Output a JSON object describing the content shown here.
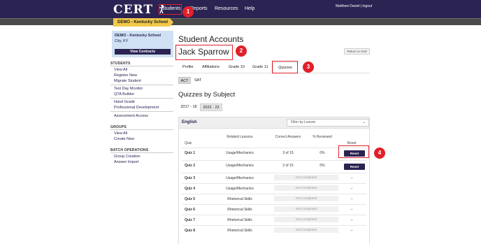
{
  "nav": {
    "logo_text": "CERT",
    "students": "Students",
    "reports": "Reports",
    "resources": "Resources",
    "help": "Help",
    "user_name": "Matthew Daniel",
    "separator": " | ",
    "logout": "logout"
  },
  "breadcrumb": {
    "school": "DEMO - Kentucky School"
  },
  "school_card": {
    "name": "DEMO - Kentucky School",
    "location": "City, KY",
    "button": "View Contracts"
  },
  "sidebar": {
    "students_heading": "STUDENTS",
    "students_links": [
      "View All",
      "Register New",
      "Migrate Student",
      "Test Day Monitor",
      "QTA Builder",
      "Hand Grade",
      "Professional Development",
      "Assessment Access"
    ],
    "groups_heading": "GROUPS",
    "groups_links": [
      "View All",
      "Create New"
    ],
    "batch_heading": "BATCH OPERATIONS",
    "batch_links": [
      "Group Creation",
      "Answer Import"
    ]
  },
  "main": {
    "page_title": "Student Accounts",
    "student_name": "Jack Sparrow",
    "return_button": "Return to Grid",
    "tabs": [
      "Profile",
      "Affiliations",
      "Grade 10",
      "Grade 11",
      "Quizzes"
    ],
    "active_tab": "Quizzes",
    "test_pills": [
      "ACT",
      "SAT"
    ],
    "active_test": "ACT",
    "section_title": "Quizzes by Subject",
    "years": [
      "2017 - 18",
      "2022 - 23"
    ],
    "active_year": "2022 - 23"
  },
  "panel": {
    "subject": "English",
    "filter_placeholder": "Filter by Lesson",
    "headers": {
      "quiz": "Quiz",
      "lessons": "Related Lessons",
      "correct": "Correct Answers",
      "reviewed": "% Reviewed",
      "reset": "Reset"
    },
    "rows": [
      {
        "quiz": "Quiz 1",
        "lesson": "Usage/Mechanics",
        "correct": "3 of 15",
        "reviewed": "0%",
        "reset": "Reset"
      },
      {
        "quiz": "Quiz 2",
        "lesson": "Usage/Mechanics",
        "correct": "2 of 15",
        "reviewed": "0%",
        "reset": "Reset"
      },
      {
        "quiz": "Quiz 3",
        "lesson": "Usage/Mechanics",
        "status": "Not Completed",
        "reset": "--"
      },
      {
        "quiz": "Quiz 4",
        "lesson": "Usage/Mechanics",
        "status": "Not Completed",
        "reset": "--"
      },
      {
        "quiz": "Quiz 5",
        "lesson": "Rhetorical Skills",
        "status": "Not Completed",
        "reset": "--"
      },
      {
        "quiz": "Quiz 6",
        "lesson": "Rhetorical Skills",
        "status": "Not Completed",
        "reset": "--"
      },
      {
        "quiz": "Quiz 7",
        "lesson": "Rhetorical Skills",
        "status": "Not Completed",
        "reset": "--"
      },
      {
        "quiz": "Quiz 8",
        "lesson": "Rhetorical Skills",
        "status": "Not Completed",
        "reset": "--"
      }
    ]
  },
  "annotations": {
    "color": "#e0202a",
    "steps": [
      "1",
      "2",
      "3",
      "4"
    ]
  },
  "colors": {
    "nav_bg": "#2b2352",
    "school_tab": "#f3c94b",
    "school_card": "#cfe1f3",
    "button_primary": "#2b2352"
  }
}
